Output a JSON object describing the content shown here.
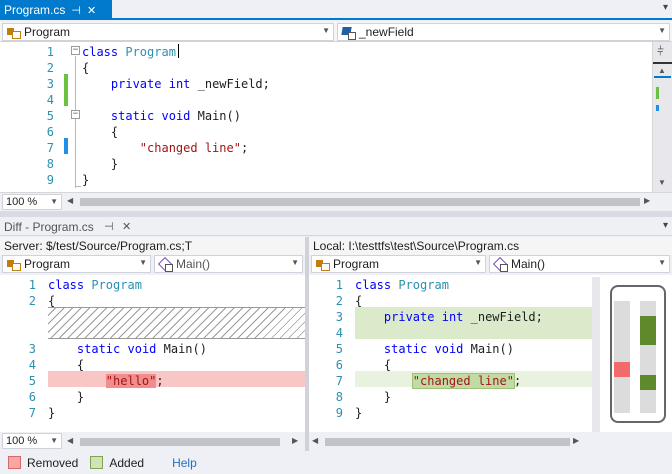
{
  "top_tab": {
    "title": "Program.cs",
    "pin_glyph": "⊣",
    "close_glyph": "✕"
  },
  "nav": {
    "class_selector": "Program",
    "member_selector": "_newField"
  },
  "editor": {
    "lines": [
      {
        "num": "1",
        "tokens": [
          {
            "t": "class ",
            "c": "kw"
          },
          {
            "t": "Program",
            "c": "ty"
          }
        ]
      },
      {
        "num": "2",
        "tokens": [
          {
            "t": "{",
            "c": ""
          }
        ]
      },
      {
        "num": "3",
        "tokens": [
          {
            "t": "    ",
            "c": ""
          },
          {
            "t": "private",
            "c": "kw"
          },
          {
            "t": " ",
            "c": ""
          },
          {
            "t": "int",
            "c": "kw"
          },
          {
            "t": " _newField;",
            "c": ""
          }
        ]
      },
      {
        "num": "4",
        "tokens": []
      },
      {
        "num": "5",
        "tokens": [
          {
            "t": "    ",
            "c": ""
          },
          {
            "t": "static",
            "c": "kw"
          },
          {
            "t": " ",
            "c": ""
          },
          {
            "t": "void",
            "c": "kw"
          },
          {
            "t": " Main()",
            "c": ""
          }
        ]
      },
      {
        "num": "6",
        "tokens": [
          {
            "t": "    {",
            "c": ""
          }
        ]
      },
      {
        "num": "7",
        "tokens": [
          {
            "t": "        ",
            "c": ""
          },
          {
            "t": "\"changed line\"",
            "c": "str"
          },
          {
            "t": ";",
            "c": ""
          }
        ]
      },
      {
        "num": "8",
        "tokens": [
          {
            "t": "    }",
            "c": ""
          }
        ]
      },
      {
        "num": "9",
        "tokens": [
          {
            "t": "}",
            "c": ""
          }
        ]
      }
    ],
    "zoom": "100 %"
  },
  "diff": {
    "tab_title": "Diff - Program.cs",
    "server_path": "Server: $/test/Source/Program.cs;T",
    "local_path": "Local: I:\\testtfs\\test\\Source\\Program.cs",
    "left_class": "Program",
    "left_member": "Main()",
    "right_class": "Program",
    "right_member": "Main()",
    "left_lines": [
      {
        "num": "1",
        "tokens": [
          {
            "t": "class ",
            "c": "kw"
          },
          {
            "t": "Program",
            "c": "ty"
          }
        ]
      },
      {
        "num": "2",
        "tokens": [
          {
            "t": "{",
            "c": ""
          }
        ]
      },
      {
        "num": "3",
        "tokens": [
          {
            "t": "    ",
            "c": ""
          },
          {
            "t": "static",
            "c": "kw"
          },
          {
            "t": " ",
            "c": ""
          },
          {
            "t": "void",
            "c": "kw"
          },
          {
            "t": " Main()",
            "c": ""
          }
        ]
      },
      {
        "num": "4",
        "tokens": [
          {
            "t": "    {",
            "c": ""
          }
        ]
      },
      {
        "num": "5",
        "tokens": [
          {
            "t": "        ",
            "c": ""
          },
          {
            "t": "\"hello\"",
            "c": "str hlr"
          },
          {
            "t": ";",
            "c": ""
          }
        ]
      },
      {
        "num": "6",
        "tokens": [
          {
            "t": "    }",
            "c": ""
          }
        ]
      },
      {
        "num": "7",
        "tokens": [
          {
            "t": "}",
            "c": ""
          }
        ]
      }
    ],
    "right_lines": [
      {
        "num": "1",
        "tokens": [
          {
            "t": "class ",
            "c": "kw"
          },
          {
            "t": "Program",
            "c": "ty"
          }
        ]
      },
      {
        "num": "2",
        "tokens": [
          {
            "t": "{",
            "c": ""
          }
        ]
      },
      {
        "num": "3",
        "tokens": [
          {
            "t": "    ",
            "c": ""
          },
          {
            "t": "private",
            "c": "kw"
          },
          {
            "t": " ",
            "c": ""
          },
          {
            "t": "int",
            "c": "kw"
          },
          {
            "t": " _newField;",
            "c": ""
          }
        ]
      },
      {
        "num": "4",
        "tokens": []
      },
      {
        "num": "5",
        "tokens": [
          {
            "t": "    ",
            "c": ""
          },
          {
            "t": "static",
            "c": "kw"
          },
          {
            "t": " ",
            "c": ""
          },
          {
            "t": "void",
            "c": "kw"
          },
          {
            "t": " Main()",
            "c": ""
          }
        ]
      },
      {
        "num": "6",
        "tokens": [
          {
            "t": "    {",
            "c": ""
          }
        ]
      },
      {
        "num": "7",
        "tokens": [
          {
            "t": "        ",
            "c": ""
          },
          {
            "t": "\"changed line\"",
            "c": "str hla"
          },
          {
            "t": ";",
            "c": ""
          }
        ]
      },
      {
        "num": "8",
        "tokens": [
          {
            "t": "    }",
            "c": ""
          }
        ]
      },
      {
        "num": "9",
        "tokens": [
          {
            "t": "}",
            "c": ""
          }
        ]
      }
    ],
    "zoom": "100 %"
  },
  "legend": {
    "removed": "Removed",
    "added": "Added",
    "help": "Help"
  },
  "colors": {
    "accent": "#007acc",
    "removed": "#f08d8d",
    "added": "#c2dba5",
    "change_bar_green": "#6bc242",
    "change_bar_blue": "#1e90e8"
  }
}
